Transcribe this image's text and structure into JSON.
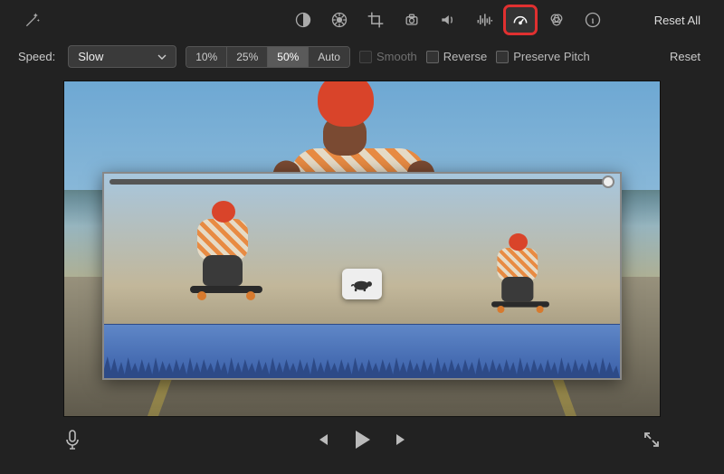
{
  "toolbar": {
    "reset_all_label": "Reset All"
  },
  "speedbar": {
    "label": "Speed:",
    "dropdown_value": "Slow",
    "preset_10": "10%",
    "preset_25": "25%",
    "preset_50": "50%",
    "auto_label": "Auto",
    "smooth_label": "Smooth",
    "reverse_label": "Reverse",
    "preserve_pitch_label": "Preserve Pitch",
    "reset_label": "Reset"
  },
  "state": {
    "active_preset": "50%",
    "active_adjustment_tool": "speed"
  }
}
